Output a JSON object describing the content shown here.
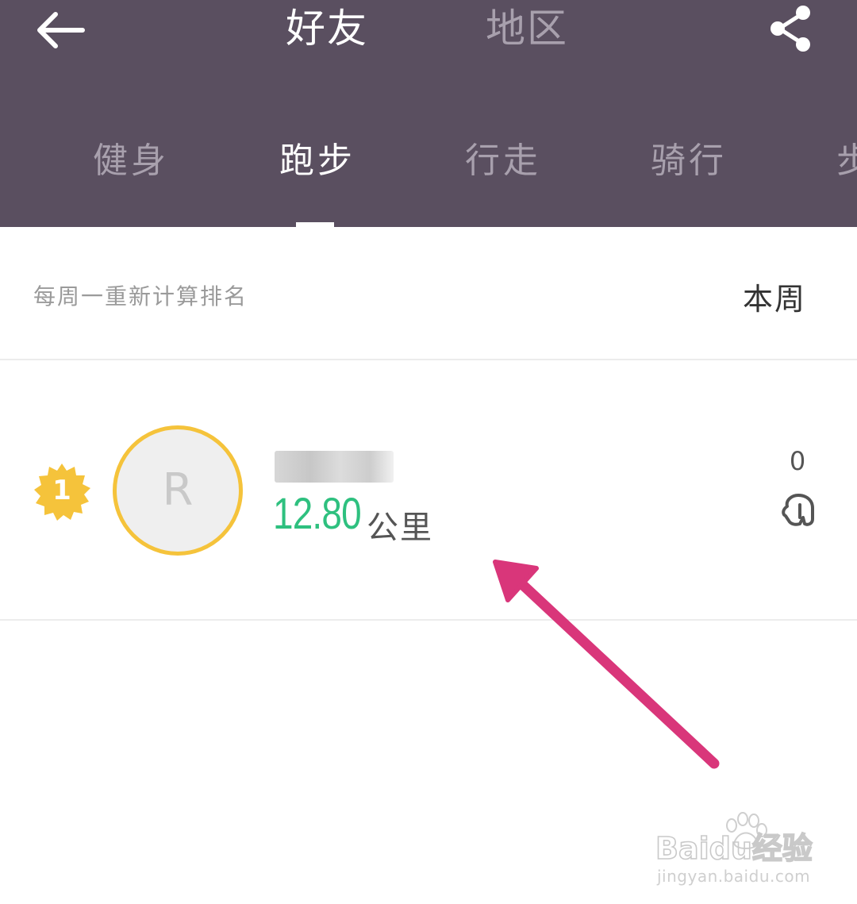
{
  "header": {
    "tabs": [
      {
        "label": "好友",
        "active": true
      },
      {
        "label": "地区",
        "active": false
      }
    ]
  },
  "sport_tabs": [
    {
      "label": "健身",
      "active": false
    },
    {
      "label": "跑步",
      "active": true
    },
    {
      "label": "行走",
      "active": false
    },
    {
      "label": "骑行",
      "active": false
    },
    {
      "label": "步",
      "active": false
    }
  ],
  "info_bar": {
    "note": "每周一重新计算排名",
    "period": "本周"
  },
  "ranking": [
    {
      "rank": "1",
      "avatar_initial": "R",
      "distance": "12.80",
      "unit": "公里",
      "likes": "0"
    }
  ],
  "watermark": {
    "logo": "Baidu经验",
    "url": "jingyan.baidu.com"
  },
  "colors": {
    "header_bg": "#5a4f60",
    "accent_green": "#2ec07f",
    "badge_gold": "#f5c33b",
    "annotation_arrow": "#d9367a"
  },
  "icons": [
    "back-arrow-icon",
    "share-icon",
    "rank-badge-icon",
    "like-hand-icon"
  ]
}
